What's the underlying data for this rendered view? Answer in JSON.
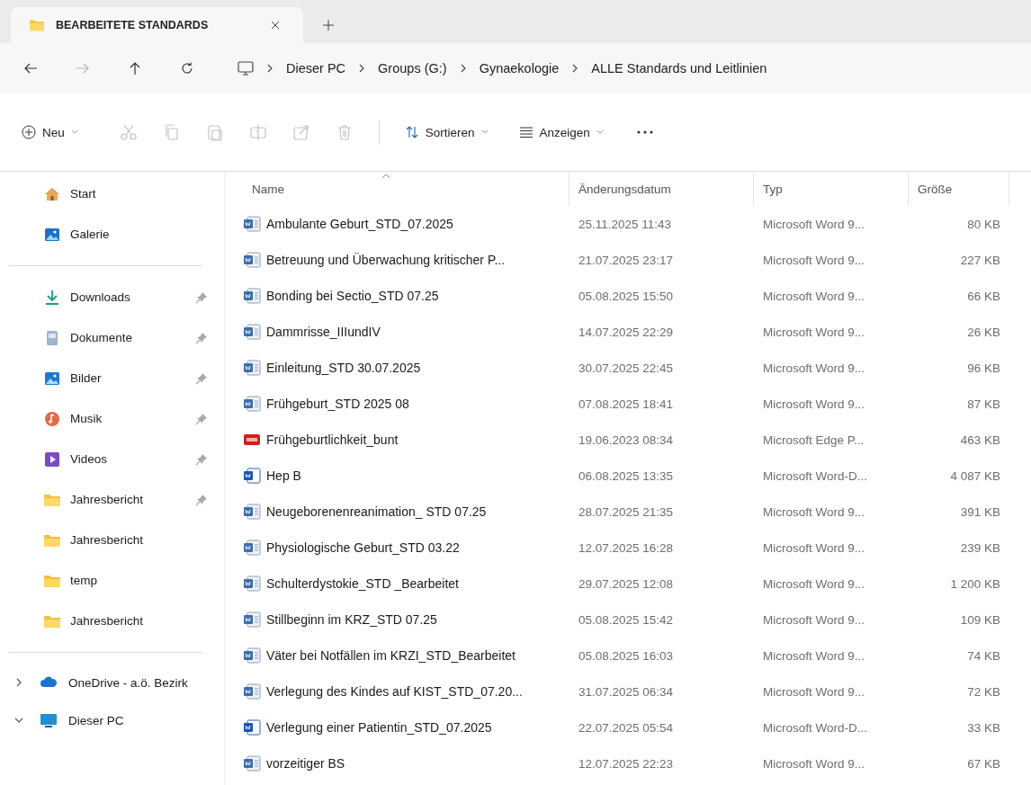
{
  "tab": {
    "title": "BEARBEITETE STANDARDS"
  },
  "nav": {
    "back_disabled": false,
    "forward_disabled": true
  },
  "breadcrumb": [
    "Dieser PC",
    "Groups (G:)",
    "Gynaekologie",
    "ALLE Standards und Leitlinien"
  ],
  "toolbar": {
    "new_label": "Neu",
    "actions": [
      {
        "kind": "cut",
        "disabled": true
      },
      {
        "kind": "copy",
        "disabled": true
      },
      {
        "kind": "paste",
        "disabled": true
      },
      {
        "kind": "rename",
        "disabled": true
      },
      {
        "kind": "share",
        "disabled": true
      },
      {
        "kind": "delete",
        "disabled": true
      }
    ],
    "sort_label": "Sortieren",
    "view_label": "Anzeigen"
  },
  "sidebar": {
    "groups": [
      [
        {
          "label": "Start",
          "kind": "home",
          "pinned": false
        },
        {
          "label": "Galerie",
          "kind": "gallery",
          "pinned": false
        }
      ],
      [
        {
          "label": "Downloads",
          "kind": "download",
          "pinned": true
        },
        {
          "label": "Dokumente",
          "kind": "documents",
          "pinned": true
        },
        {
          "label": "Bilder",
          "kind": "pictures",
          "pinned": true
        },
        {
          "label": "Musik",
          "kind": "music",
          "pinned": true
        },
        {
          "label": "Videos",
          "kind": "videos",
          "pinned": true
        },
        {
          "label": "Jahresbericht",
          "kind": "folder",
          "pinned": true
        },
        {
          "label": "Jahresbericht",
          "kind": "folder",
          "pinned": false
        },
        {
          "label": "temp",
          "kind": "folder",
          "pinned": false
        },
        {
          "label": "Jahresbericht",
          "kind": "folder",
          "pinned": false
        }
      ]
    ],
    "tree": [
      {
        "label": "OneDrive - a.ö. Bezirk",
        "kind": "cloud",
        "expanded": false
      },
      {
        "label": "Dieser PC",
        "kind": "pc",
        "expanded": true
      }
    ]
  },
  "table": {
    "columns": [
      {
        "label": "Name",
        "sorted": true
      },
      {
        "label": "Änderungsdatum",
        "sorted": false
      },
      {
        "label": "Typ",
        "sorted": false
      },
      {
        "label": "Größe",
        "sorted": false
      }
    ],
    "rows": [
      {
        "kind": "word97",
        "name": "Ambulante Geburt_STD_07.2025",
        "date": "25.11.2025 11:43",
        "type": "Microsoft Word 9...",
        "size": "80 KB"
      },
      {
        "kind": "word97",
        "name": "Betreuung und Überwachung kritischer P...",
        "date": "21.07.2025 23:17",
        "type": "Microsoft Word 9...",
        "size": "227 KB"
      },
      {
        "kind": "word97",
        "name": "Bonding bei Sectio_STD 07.25",
        "date": "05.08.2025 15:50",
        "type": "Microsoft Word 9...",
        "size": "66 KB"
      },
      {
        "kind": "word97",
        "name": "Dammrisse_IIIundIV",
        "date": "14.07.2025 22:29",
        "type": "Microsoft Word 9...",
        "size": "26 KB"
      },
      {
        "kind": "word97",
        "name": "Einleitung_STD 30.07.2025",
        "date": "30.07.2025 22:45",
        "type": "Microsoft Word 9...",
        "size": "96 KB"
      },
      {
        "kind": "word97",
        "name": "Frühgeburt_STD 2025 08",
        "date": "07.08.2025 18:41",
        "type": "Microsoft Word 9...",
        "size": "87 KB"
      },
      {
        "kind": "pdf",
        "name": "Frühgeburtlichkeit_bunt",
        "date": "19.06.2023 08:34",
        "type": "Microsoft Edge P...",
        "size": "463 KB"
      },
      {
        "kind": "word",
        "name": "Hep B",
        "date": "06.08.2025 13:35",
        "type": "Microsoft Word-D...",
        "size": "4 087 KB"
      },
      {
        "kind": "word97",
        "name": "Neugeborenenreanimation_ STD 07.25",
        "date": "28.07.2025 21:35",
        "type": "Microsoft Word 9...",
        "size": "391 KB"
      },
      {
        "kind": "word97",
        "name": "Physiologische Geburt_STD 03.22",
        "date": "12.07.2025 16:28",
        "type": "Microsoft Word 9...",
        "size": "239 KB"
      },
      {
        "kind": "word97",
        "name": "Schulterdystokie_STD _Bearbeitet",
        "date": "29.07.2025 12:08",
        "type": "Microsoft Word 9...",
        "size": "1 200 KB"
      },
      {
        "kind": "word97",
        "name": "Stillbeginn im KRZ_STD 07.25",
        "date": "05.08.2025 15:42",
        "type": "Microsoft Word 9...",
        "size": "109 KB"
      },
      {
        "kind": "word97",
        "name": "Väter bei Notfällen im KRZI_STD_Bearbeitet",
        "date": "05.08.2025 16:03",
        "type": "Microsoft Word 9...",
        "size": "74 KB"
      },
      {
        "kind": "word97",
        "name": "Verlegung des Kindes auf KIST_STD_07.20...",
        "date": "31.07.2025 06:34",
        "type": "Microsoft Word 9...",
        "size": "72 KB"
      },
      {
        "kind": "word",
        "name": "Verlegung einer Patientin_STD_07.2025",
        "date": "22.07.2025 05:54",
        "type": "Microsoft Word-D...",
        "size": "33 KB"
      },
      {
        "kind": "word97",
        "name": "vorzeitiger BS",
        "date": "12.07.2025 22:23",
        "type": "Microsoft Word 9...",
        "size": "67 KB"
      }
    ]
  }
}
